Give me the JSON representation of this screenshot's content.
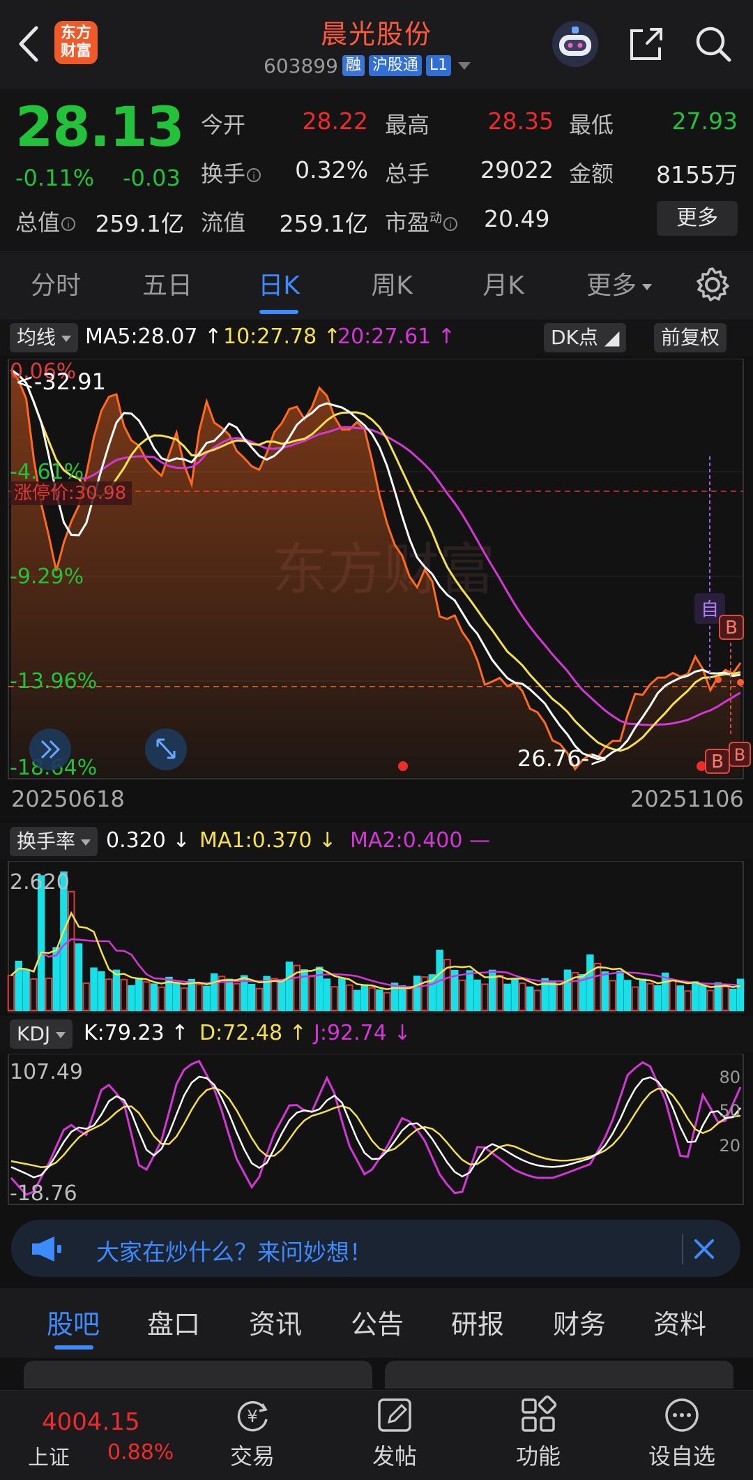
{
  "header": {
    "stock_name": "晨光股份",
    "code": "603899",
    "tags": [
      "融",
      "沪股通",
      "L1"
    ]
  },
  "quote": {
    "price": "28.13",
    "change_pct": "-0.11%",
    "change_val": "-0.03",
    "open_label": "今开",
    "open": "28.22",
    "high_label": "最高",
    "high": "28.35",
    "low_label": "最低",
    "low": "27.93",
    "turnover_label": "换手",
    "turnover": "0.32%",
    "volume_label": "总手",
    "volume": "29022",
    "amount_label": "金额",
    "amount": "8155万",
    "mktcap_label": "总值",
    "mktcap": "259.1亿",
    "float_label": "流值",
    "float": "259.1亿",
    "pe_label": "市盈",
    "pe_sup": "动",
    "pe": "20.49",
    "more_label": "更多"
  },
  "period_tabs": [
    "分时",
    "五日",
    "日K",
    "周K",
    "月K",
    "更多"
  ],
  "kline": {
    "selector": "均线",
    "ma5": "MA5:28.07",
    "ma10": "10:27.78",
    "ma20": "20:27.61",
    "dk_label": "DK点",
    "adjust_label": "前复权",
    "pct_labels": [
      "0.06%",
      "-4.61%",
      "-9.29%",
      "-13.96%",
      "-18.64%"
    ],
    "high_marker": "<-32.91",
    "low_marker": "26.76->",
    "limit_up": "涨停价:30.98",
    "watermark": "东方财富",
    "self_tag": "自",
    "buy_tag": "B",
    "date_start": "20250618",
    "date_end": "20251106"
  },
  "turnover_panel": {
    "selector": "换手率",
    "value": "0.320",
    "ma1": "MA1:0.370",
    "ma2": "MA2:0.400",
    "max_label": "2.620"
  },
  "kdj_panel": {
    "selector": "KDJ",
    "k": "K:79.23",
    "d": "D:72.48",
    "j": "J:92.74",
    "max_label": "107.49",
    "min_label": "-18.76",
    "right_labels": [
      "80",
      "50",
      "20"
    ]
  },
  "banner": {
    "text": "大家在炒什么？来问妙想！"
  },
  "info_tabs": [
    "股吧",
    "盘口",
    "资讯",
    "公告",
    "研报",
    "财务",
    "资料"
  ],
  "bottom_nav": {
    "index_value": "4004.15",
    "index_name": "上证",
    "index_pct": "0.88%",
    "items": [
      "交易",
      "发帖",
      "功能",
      "设自选"
    ]
  },
  "colors": {
    "up": "#f02b2b",
    "down": "#22c33a",
    "accent": "#3d8bff",
    "ma5": "#ffffff",
    "ma10": "#f5e14a",
    "ma20": "#d536d8",
    "close_line": "#ff6a1f"
  }
}
